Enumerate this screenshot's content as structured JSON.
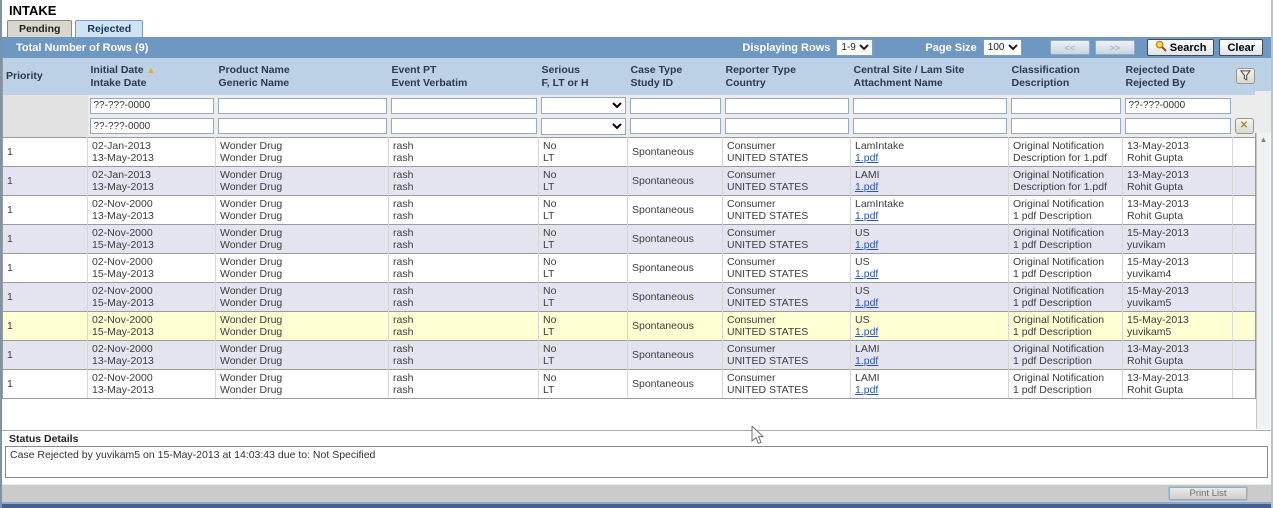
{
  "window": {
    "title": "INTAKE"
  },
  "tabs": [
    {
      "label": "Pending",
      "active": false
    },
    {
      "label": "Rejected",
      "active": true
    }
  ],
  "toolbar": {
    "total_rows_label": "Total Number of Rows (9)",
    "displaying_rows_label": "Displaying Rows",
    "displaying_rows_value": "1-9",
    "page_size_label": "Page Size",
    "page_size_value": "100",
    "prev_label": "<<",
    "next_label": ">>",
    "search_label": "Search",
    "clear_label": "Clear"
  },
  "icons": {
    "sort_asc": "▲",
    "scroll_up": "▲",
    "clear_filter": "✕"
  },
  "colors": {
    "toolbar_blue": "#6e97c2",
    "header_blue": "#bdd1e6",
    "row_alt": "#e4e4f1",
    "row_selected": "#ffffd4",
    "link": "#2a52be",
    "sort_arrow": "#f5a623"
  },
  "table": {
    "columns": [
      {
        "line1": "Priority",
        "line2": ""
      },
      {
        "line1": "Initial Date",
        "line2": "Intake Date"
      },
      {
        "line1": "Product Name",
        "line2": "Generic Name"
      },
      {
        "line1": "Event PT",
        "line2": "Event Verbatim"
      },
      {
        "line1": "Serious",
        "line2": "F, LT or H"
      },
      {
        "line1": "Case Type",
        "line2": "Study ID"
      },
      {
        "line1": "Reporter Type",
        "line2": "Country"
      },
      {
        "line1": "Central Site / Lam Site",
        "line2": "Attachment Name"
      },
      {
        "line1": "Classification",
        "line2": "Description"
      },
      {
        "line1": "Rejected Date",
        "line2": "Rejected By"
      }
    ],
    "filters": {
      "row1": {
        "initial_date": "??-???-0000",
        "product": "",
        "event_pt": "",
        "serious": "",
        "case_type": "",
        "reporter": "",
        "site": "",
        "classification": "",
        "rejected_date": "??-???-0000"
      },
      "row2": {
        "initial_date": "??-???-0000",
        "product": "",
        "event_pt": "",
        "serious": "",
        "case_type": "",
        "reporter": "",
        "site": "",
        "classification": "",
        "rejected_date": ""
      }
    },
    "rows": [
      {
        "priority": "1",
        "initial_date": "02-Jan-2013",
        "intake_date": "13-May-2013",
        "product": "Wonder Drug",
        "generic": "Wonder Drug",
        "event_pt": "rash",
        "event_verbatim": "rash",
        "serious": "No",
        "flt": "LT",
        "case_type": "Spontaneous",
        "study_id": "",
        "reporter": "Consumer",
        "country": "UNITED STATES",
        "site": "LamIntake",
        "attachment": "1.pdf",
        "classification": "Original Notification",
        "description": "Description for 1.pdf",
        "rejected_date": "13-May-2013",
        "rejected_by": "Rohit Gupta",
        "highlight": false
      },
      {
        "priority": "1",
        "initial_date": "02-Jan-2013",
        "intake_date": "13-May-2013",
        "product": "Wonder Drug",
        "generic": "Wonder Drug",
        "event_pt": "rash",
        "event_verbatim": "rash",
        "serious": "No",
        "flt": "LT",
        "case_type": "Spontaneous",
        "study_id": "",
        "reporter": "Consumer",
        "country": "UNITED STATES",
        "site": "LAMI",
        "attachment": "1.pdf",
        "classification": "Original Notification",
        "description": "Description for 1.pdf",
        "rejected_date": "13-May-2013",
        "rejected_by": "Rohit Gupta",
        "highlight": false
      },
      {
        "priority": "1",
        "initial_date": "02-Nov-2000",
        "intake_date": "13-May-2013",
        "product": "Wonder Drug",
        "generic": "Wonder Drug",
        "event_pt": "rash",
        "event_verbatim": "rash",
        "serious": "No",
        "flt": "LT",
        "case_type": "Spontaneous",
        "study_id": "",
        "reporter": "Consumer",
        "country": "UNITED STATES",
        "site": "LamIntake",
        "attachment": "1.pdf",
        "classification": "Original Notification",
        "description": "1 pdf Description",
        "rejected_date": "13-May-2013",
        "rejected_by": "Rohit Gupta",
        "highlight": false
      },
      {
        "priority": "1",
        "initial_date": "02-Nov-2000",
        "intake_date": "15-May-2013",
        "product": "Wonder Drug",
        "generic": "Wonder Drug",
        "event_pt": "rash",
        "event_verbatim": "rash",
        "serious": "No",
        "flt": "LT",
        "case_type": "Spontaneous",
        "study_id": "",
        "reporter": "Consumer",
        "country": "UNITED STATES",
        "site": "US",
        "attachment": "1.pdf",
        "classification": "Original Notification",
        "description": "1 pdf Description",
        "rejected_date": "15-May-2013",
        "rejected_by": "yuvikam",
        "highlight": false
      },
      {
        "priority": "1",
        "initial_date": "02-Nov-2000",
        "intake_date": "15-May-2013",
        "product": "Wonder Drug",
        "generic": "Wonder Drug",
        "event_pt": "rash",
        "event_verbatim": "rash",
        "serious": "No",
        "flt": "LT",
        "case_type": "Spontaneous",
        "study_id": "",
        "reporter": "Consumer",
        "country": "UNITED STATES",
        "site": "US",
        "attachment": "1.pdf",
        "classification": "Original Notification",
        "description": "1 pdf Description",
        "rejected_date": "15-May-2013",
        "rejected_by": "yuvikam4",
        "highlight": false
      },
      {
        "priority": "1",
        "initial_date": "02-Nov-2000",
        "intake_date": "15-May-2013",
        "product": "Wonder Drug",
        "generic": "Wonder Drug",
        "event_pt": "rash",
        "event_verbatim": "rash",
        "serious": "No",
        "flt": "LT",
        "case_type": "Spontaneous",
        "study_id": "",
        "reporter": "Consumer",
        "country": "UNITED STATES",
        "site": "US",
        "attachment": "1.pdf",
        "classification": "Original Notification",
        "description": "1 pdf Description",
        "rejected_date": "15-May-2013",
        "rejected_by": "yuvikam5",
        "highlight": false
      },
      {
        "priority": "1",
        "initial_date": "02-Nov-2000",
        "intake_date": "15-May-2013",
        "product": "Wonder Drug",
        "generic": "Wonder Drug",
        "event_pt": "rash",
        "event_verbatim": "rash",
        "serious": "No",
        "flt": "LT",
        "case_type": "Spontaneous",
        "study_id": "",
        "reporter": "Consumer",
        "country": "UNITED STATES",
        "site": "US",
        "attachment": "1.pdf",
        "classification": "Original Notification",
        "description": "1 pdf Description",
        "rejected_date": "15-May-2013",
        "rejected_by": "yuvikam5",
        "highlight": true
      },
      {
        "priority": "1",
        "initial_date": "02-Nov-2000",
        "intake_date": "13-May-2013",
        "product": "Wonder Drug",
        "generic": "Wonder Drug",
        "event_pt": "rash",
        "event_verbatim": "rash",
        "serious": "No",
        "flt": "LT",
        "case_type": "Spontaneous",
        "study_id": "",
        "reporter": "Consumer",
        "country": "UNITED STATES",
        "site": "LAMI",
        "attachment": "1.pdf",
        "classification": "Original Notification",
        "description": "1 pdf Description",
        "rejected_date": "13-May-2013",
        "rejected_by": "Rohit Gupta",
        "highlight": false
      },
      {
        "priority": "1",
        "initial_date": "02-Nov-2000",
        "intake_date": "13-May-2013",
        "product": "Wonder Drug",
        "generic": "Wonder Drug",
        "event_pt": "rash",
        "event_verbatim": "rash",
        "serious": "No",
        "flt": "LT",
        "case_type": "Spontaneous",
        "study_id": "",
        "reporter": "Consumer",
        "country": "UNITED STATES",
        "site": "LAMI",
        "attachment": "1.pdf",
        "classification": "Original Notification",
        "description": "1 pdf Description",
        "rejected_date": "13-May-2013",
        "rejected_by": "Rohit Gupta",
        "highlight": false
      }
    ]
  },
  "status": {
    "title": "Status Details",
    "message": "Case Rejected by yuvikam5 on 15-May-2013 at 14:03:43 due to: Not Specified"
  },
  "footer": {
    "print_label": "Print List"
  }
}
